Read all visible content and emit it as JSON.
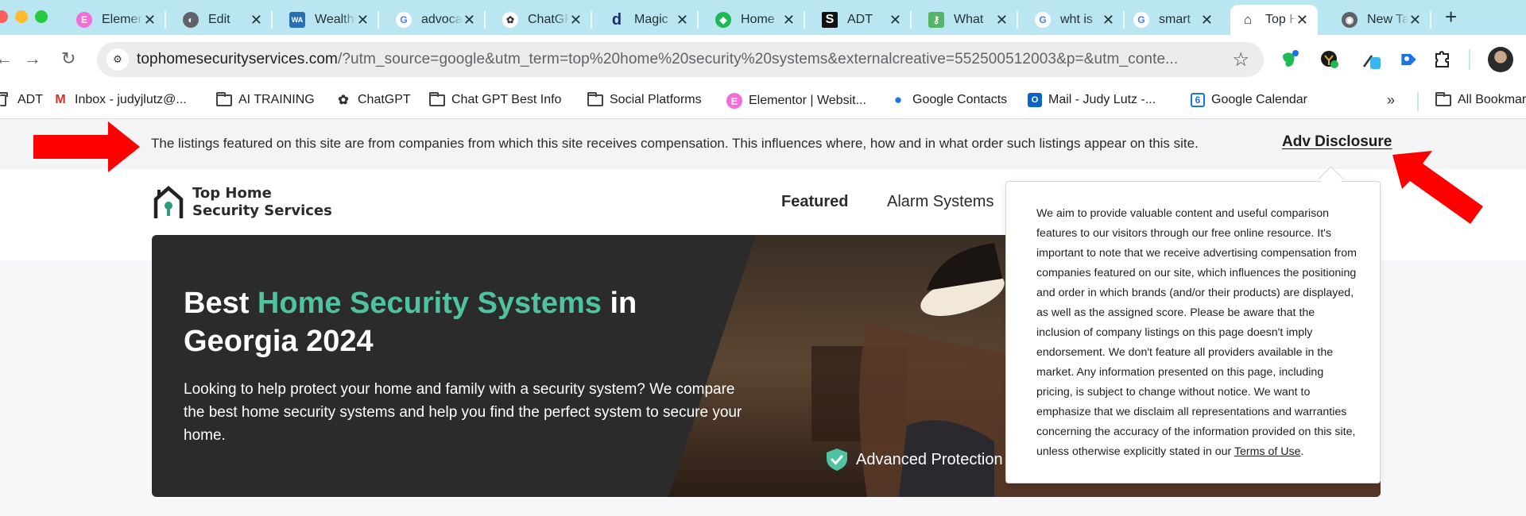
{
  "browser": {
    "tabs": [
      {
        "label": "Elementor",
        "icon": "elementor-icon",
        "color": "#f26dd6"
      },
      {
        "label": "Edit",
        "icon": "globe-icon",
        "color": "#5f6368"
      },
      {
        "label": "Wealthy Affiliate",
        "icon": "wealthy-affiliate-icon",
        "color": "#2a6fb2"
      },
      {
        "label": "advocate",
        "icon": "google-icon",
        "color": "#4285f4"
      },
      {
        "label": "ChatGPT",
        "icon": "openai-icon",
        "color": "#333333"
      },
      {
        "label": "Magic",
        "icon": "magic-icon",
        "color": "#1e2a78"
      },
      {
        "label": "Home",
        "icon": "evernote-icon",
        "color": "#1db954"
      },
      {
        "label": "ADT",
        "icon": "s-logo-icon",
        "color": "#111111"
      },
      {
        "label": "What",
        "icon": "key-badge-icon",
        "color": "#52b56a"
      },
      {
        "label": "wht is",
        "icon": "google-icon",
        "color": "#4285f4"
      },
      {
        "label": "smart",
        "icon": "google-icon",
        "color": "#4285f4"
      },
      {
        "label": "Top Home",
        "icon": "house-key-icon",
        "color": "#2b2b2b",
        "active": true
      },
      {
        "label": "New Tab",
        "icon": "chrome-icon",
        "color": "#5f6368"
      }
    ],
    "new_tab_label": "+",
    "url_domain": "tophomesecurityservices.com",
    "url_rest": "/?utm_source=google&utm_term=top%20home%20security%20systems&externalcreative=552500512003&p=&utm_conte...",
    "bookmarks": [
      {
        "label": "ADT",
        "icon": "folder-icon"
      },
      {
        "label": "Inbox - judyjlutz@...",
        "icon": "gmail-icon"
      },
      {
        "label": "AI TRAINING",
        "icon": "folder-icon"
      },
      {
        "label": "ChatGPT",
        "icon": "openai-icon"
      },
      {
        "label": "Chat GPT Best Info",
        "icon": "folder-icon"
      },
      {
        "label": "Social Platforms",
        "icon": "folder-icon"
      },
      {
        "label": "Elementor | Websit...",
        "icon": "elementor-icon"
      },
      {
        "label": "Google Contacts",
        "icon": "contacts-icon"
      },
      {
        "label": "Mail - Judy Lutz -...",
        "icon": "outlook-icon"
      },
      {
        "label": "Google Calendar",
        "icon": "calendar-icon"
      }
    ],
    "bookmarks_overflow": "»",
    "all_bookmarks": "All Bookmarks",
    "calendar_day": "6"
  },
  "page": {
    "disclosure_text": "The listings featured on this site are from companies from which this site receives compensation. This influences where, how and in what order such listings appear on this site.",
    "adv_disclosure_label": "Adv Disclosure",
    "logo_line1": "Top Home",
    "logo_line2": "Security Services",
    "nav": [
      {
        "label": "Featured",
        "active": true
      },
      {
        "label": "Alarm Systems",
        "active": false
      }
    ],
    "hero": {
      "title_prefix": "Best ",
      "title_accent": "Home Security Systems",
      "title_suffix": " in Georgia 2024",
      "subtitle": "Looking to help protect your home and family with a security system? We compare the best home security systems and help you find the perfect system to secure your home.",
      "badge_label": "Advanced Protection"
    },
    "popover": {
      "text": "We aim to provide valuable content and useful comparison features to our visitors through our free online resource. It's important to note that we receive advertising compensation from companies featured on our site, which influences the positioning and order in which brands (and/or their products) are displayed, as well as the assigned score. Please be aware that the inclusion of company listings on this page doesn't imply endorsement. We don't feature all providers available in the market. Any information presented on this page, including pricing, is subject to change without notice. We want to emphasize that we disclaim all representations and warranties concerning the accuracy of the information provided on this site, unless otherwise explicitly stated in our ",
      "link_label": "Terms of Use",
      "end": "."
    },
    "colors": {
      "accent": "#4fc3a1",
      "annotation": "#ff0000",
      "hero_bg": "#2b2b2b"
    }
  }
}
